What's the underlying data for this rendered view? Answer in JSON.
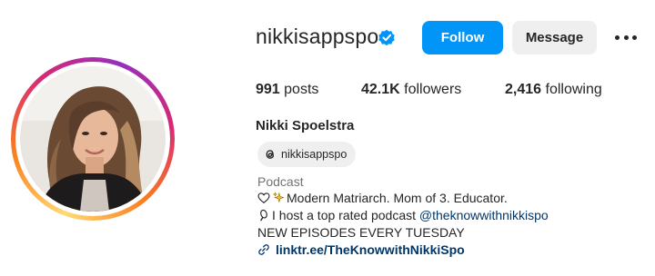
{
  "profile": {
    "username": "nikkisappspo",
    "verified": true,
    "full_name": "Nikki Spoelstra",
    "threads_handle": "nikkisappspo",
    "category": "Podcast"
  },
  "actions": {
    "follow_label": "Follow",
    "message_label": "Message",
    "more_icon": "more-horizontal-icon"
  },
  "stats": {
    "posts_count": "991",
    "posts_label": " posts",
    "followers_count": "42.1K",
    "followers_label": " followers",
    "following_count": "2,416",
    "following_label": " following"
  },
  "bio": {
    "line1": "Modern Matriarch. Mom of 3. Educator.",
    "line2_text": "I host a top rated podcast ",
    "line2_mention": "@theknowwithnikkispo",
    "line3": "NEW EPISODES EVERY TUESDAY",
    "link": "linktr.ee/TheKnowwithNikkiSpo"
  },
  "colors": {
    "follow_button": "#0095f6",
    "message_button": "#efefef",
    "verified_badge": "#0095f6",
    "link": "#00376b",
    "category": "#737373"
  }
}
